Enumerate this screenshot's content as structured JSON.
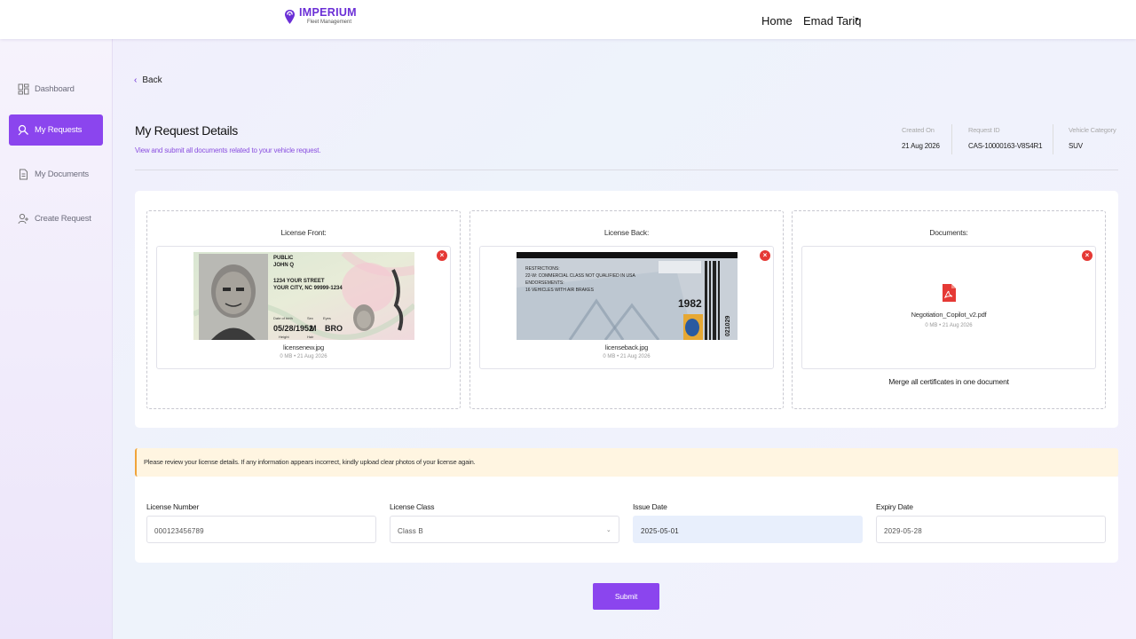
{
  "brand": {
    "name": "IMPERIUM",
    "tagline": "Fleet Management",
    "accent": "#8b45ee",
    "title_color": "#6b2fd6"
  },
  "header": {
    "home": "Home",
    "user_name": "Emad Tariq"
  },
  "sidebar": {
    "items": [
      {
        "label": "Dashboard",
        "icon": "dashboard-icon",
        "active": false
      },
      {
        "label": "My Requests",
        "icon": "requests-icon",
        "active": true
      },
      {
        "label": "My Documents",
        "icon": "document-icon",
        "active": false
      },
      {
        "label": "Create Request",
        "icon": "add-user-icon",
        "active": false
      }
    ]
  },
  "main": {
    "back_label": "Back",
    "title": "My Request Details",
    "subtitle": "View and submit all documents related to your vehicle request.",
    "meta": [
      {
        "label": "Created On",
        "value": "21 Aug 2026"
      },
      {
        "label": "Request ID",
        "value": "CAS-10000163-V8S4R1"
      },
      {
        "label": "Vehicle Category",
        "value": "SUV"
      }
    ],
    "uploads": [
      {
        "title": "License Front:",
        "file_name": "licensenew.jpg",
        "file_meta": "0 MB • 21 Aug 2026"
      },
      {
        "title": "License Back:",
        "file_name": "licenseback.jpg",
        "file_meta": "0 MB • 21 Aug 2026"
      },
      {
        "title": "Documents:",
        "file_name": "Negotiation_Copilot_v2.pdf",
        "file_meta": "0 MB • 21 Aug 2026",
        "note": "Merge all certificates in one document"
      }
    ],
    "license_front_card": {
      "last": "PUBLIC",
      "first": "JOHN Q",
      "street": "1234 YOUR STREET",
      "city": "YOUR CITY, NC 99999-1234",
      "dob_label": "Date of birth",
      "dob": "05/28/1952",
      "sex_label": "Sex",
      "sex": "M",
      "eyes_label": "Eyes",
      "eyes": "BRO",
      "height_label": "Height",
      "hair_label": "Hair"
    },
    "license_back_card": {
      "restrictions": "RESTRICTIONS:",
      "line1": "22-W: COMMERCIAL CLASS NOT QUALIFIED IN USA",
      "line2": "ENDORSEMENTS:",
      "line3": "16 VEHICLES WITH AIR BRAKES",
      "year": "1982",
      "serial": "021029"
    },
    "notice": "Please review your license details. If any information appears incorrect, kindly upload clear photos of your license again.",
    "form": {
      "license_number": {
        "label": "License Number",
        "value": "000123456789"
      },
      "license_class": {
        "label": "License Class",
        "value": "Class B"
      },
      "issue_date": {
        "label": "Issue Date",
        "value": "2025-05-01"
      },
      "expiry_date": {
        "label": "Expiry Date",
        "value": "2029-05-28"
      }
    },
    "submit_label": "Submit"
  }
}
